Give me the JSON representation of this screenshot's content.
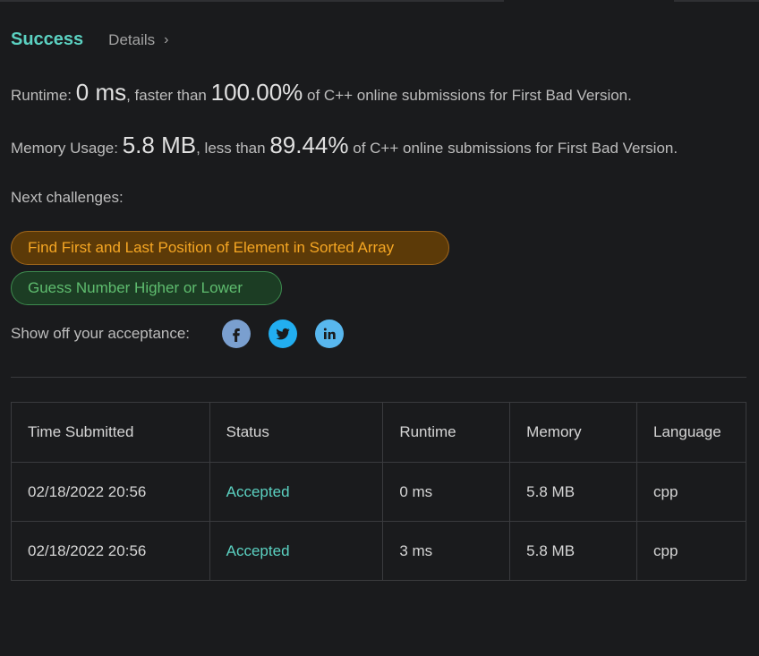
{
  "status": {
    "result": "Success",
    "details_label": "Details",
    "chevron": "›"
  },
  "runtime": {
    "label": "Runtime:",
    "value": "0 ms",
    "middle": ", faster than",
    "percent": "100.00%",
    "suffix": "of C++ online submissions for First Bad Version."
  },
  "memory": {
    "label": "Memory Usage:",
    "value": "5.8 MB",
    "middle": ", less than",
    "percent": "89.44%",
    "suffix": "of C++ online submissions for First Bad Version."
  },
  "next": {
    "label": "Next challenges:",
    "challenges": [
      {
        "title": "Find First and Last Position of Element in Sorted Array",
        "difficulty_color": "#f5a623"
      },
      {
        "title": "Guess Number Higher or Lower",
        "difficulty_color": "#5fbd6f"
      }
    ]
  },
  "share": {
    "label": "Show off your acceptance:",
    "icons": [
      "facebook-icon",
      "twitter-icon",
      "linkedin-icon"
    ]
  },
  "table": {
    "headers": [
      "Time Submitted",
      "Status",
      "Runtime",
      "Memory",
      "Language"
    ],
    "rows": [
      [
        "02/18/2022 20:56",
        "Accepted",
        "0 ms",
        "5.8 MB",
        "cpp"
      ],
      [
        "02/18/2022 20:56",
        "Accepted",
        "3 ms",
        "5.8 MB",
        "cpp"
      ]
    ]
  },
  "colors": {
    "success": "#5bd1c1",
    "background": "#1a1b1d"
  }
}
